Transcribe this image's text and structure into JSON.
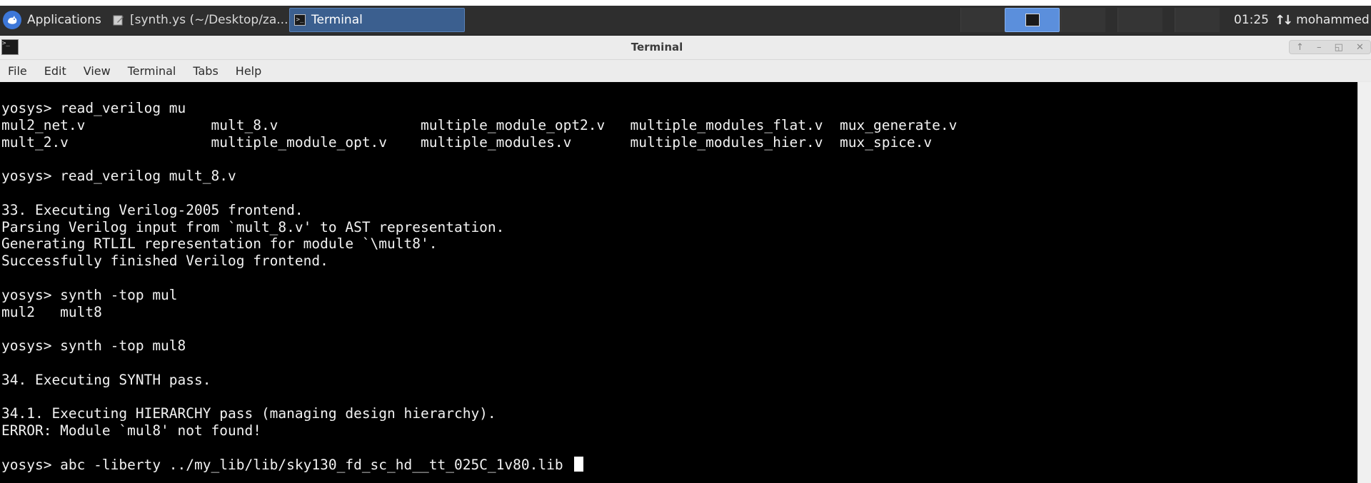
{
  "taskbar": {
    "applications_label": "Applications",
    "task1_label": "[synth.ys (~/Desktop/za...",
    "task2_label": "Terminal",
    "clock": "01:25",
    "user": "mohammed"
  },
  "window": {
    "title": "Terminal",
    "menu": [
      "File",
      "Edit",
      "View",
      "Terminal",
      "Tabs",
      "Help"
    ]
  },
  "terminal": {
    "lines": [
      "yosys> read_verilog mu",
      "mul2_net.v               mult_8.v                 multiple_module_opt2.v   multiple_modules_flat.v  mux_generate.v",
      "mult_2.v                 multiple_module_opt.v    multiple_modules.v       multiple_modules_hier.v  mux_spice.v",
      "",
      "yosys> read_verilog mult_8.v",
      "",
      "33. Executing Verilog-2005 frontend.",
      "Parsing Verilog input from `mult_8.v' to AST representation.",
      "Generating RTLIL representation for module `\\mult8'.",
      "Successfully finished Verilog frontend.",
      "",
      "yosys> synth -top mul",
      "mul2   mult8",
      "",
      "yosys> synth -top mul8",
      "",
      "34. Executing SYNTH pass.",
      "",
      "34.1. Executing HIERARCHY pass (managing design hierarchy).",
      "ERROR: Module `mul8' not found!",
      "",
      "yosys> abc -liberty ../my_lib/lib/sky130_fd_sc_hd__tt_025C_1v80.lib "
    ]
  }
}
